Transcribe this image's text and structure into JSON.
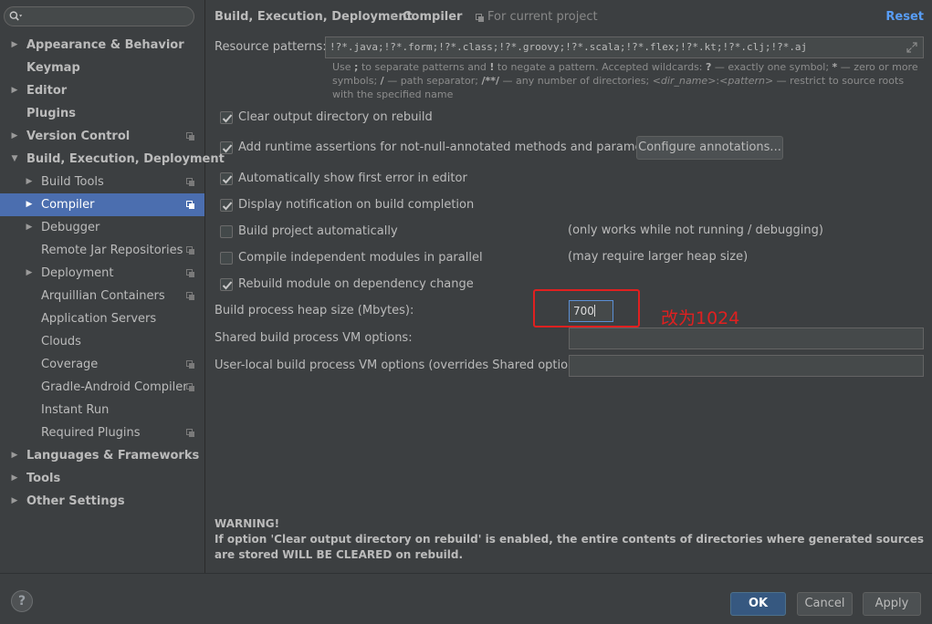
{
  "search": {
    "placeholder": ""
  },
  "sidebar": {
    "items": [
      {
        "label": "Appearance & Behavior",
        "bold": true,
        "expandable": true,
        "expanded": false,
        "level": 0,
        "project_icon": false
      },
      {
        "label": "Keymap",
        "bold": true,
        "expandable": false,
        "level": 0,
        "project_icon": false
      },
      {
        "label": "Editor",
        "bold": true,
        "expandable": true,
        "expanded": false,
        "level": 0,
        "project_icon": false
      },
      {
        "label": "Plugins",
        "bold": true,
        "expandable": false,
        "level": 0,
        "project_icon": false
      },
      {
        "label": "Version Control",
        "bold": true,
        "expandable": true,
        "expanded": false,
        "level": 0,
        "project_icon": true
      },
      {
        "label": "Build, Execution, Deployment",
        "bold": true,
        "expandable": true,
        "expanded": true,
        "level": 0,
        "project_icon": false
      },
      {
        "label": "Build Tools",
        "bold": false,
        "expandable": true,
        "expanded": false,
        "level": 1,
        "project_icon": true
      },
      {
        "label": "Compiler",
        "bold": false,
        "expandable": true,
        "expanded": false,
        "level": 1,
        "project_icon": true,
        "selected": true
      },
      {
        "label": "Debugger",
        "bold": false,
        "expandable": true,
        "expanded": false,
        "level": 1,
        "project_icon": false
      },
      {
        "label": "Remote Jar Repositories",
        "bold": false,
        "expandable": false,
        "level": 1,
        "project_icon": true
      },
      {
        "label": "Deployment",
        "bold": false,
        "expandable": true,
        "expanded": false,
        "level": 1,
        "project_icon": true
      },
      {
        "label": "Arquillian Containers",
        "bold": false,
        "expandable": false,
        "level": 1,
        "project_icon": true
      },
      {
        "label": "Application Servers",
        "bold": false,
        "expandable": false,
        "level": 1,
        "project_icon": false
      },
      {
        "label": "Clouds",
        "bold": false,
        "expandable": false,
        "level": 1,
        "project_icon": false
      },
      {
        "label": "Coverage",
        "bold": false,
        "expandable": false,
        "level": 1,
        "project_icon": true
      },
      {
        "label": "Gradle-Android Compiler",
        "bold": false,
        "expandable": false,
        "level": 1,
        "project_icon": true
      },
      {
        "label": "Instant Run",
        "bold": false,
        "expandable": false,
        "level": 1,
        "project_icon": false
      },
      {
        "label": "Required Plugins",
        "bold": false,
        "expandable": false,
        "level": 1,
        "project_icon": true
      },
      {
        "label": "Languages & Frameworks",
        "bold": true,
        "expandable": true,
        "expanded": false,
        "level": 0,
        "project_icon": false
      },
      {
        "label": "Tools",
        "bold": true,
        "expandable": true,
        "expanded": false,
        "level": 0,
        "project_icon": false
      },
      {
        "label": "Other Settings",
        "bold": true,
        "expandable": true,
        "expanded": false,
        "level": 0,
        "project_icon": false
      }
    ]
  },
  "header": {
    "crumb1": "Build, Execution, Deployment",
    "separator": "›",
    "crumb2": "Compiler",
    "for_project": "For current project",
    "reset": "Reset"
  },
  "resource": {
    "label": "Resource patterns:",
    "value": "!?*.java;!?*.form;!?*.class;!?*.groovy;!?*.scala;!?*.flex;!?*.kt;!?*.clj;!?*.aj"
  },
  "hint": {
    "p1": "Use ",
    "s1": ";",
    "p2": " to separate patterns and ",
    "s2": "!",
    "p3": " to negate a pattern. Accepted wildcards: ",
    "s3": "?",
    "p4": " — exactly one symbol; ",
    "s4": "*",
    "p5": " — zero or more symbols; ",
    "s5": "/",
    "p6": " — path separator; ",
    "s6": "/**/",
    "p7": " — any number of directories; ",
    "s7": "<dir_name>",
    "p8": ":",
    "s8": "<pattern>",
    "p9": " — restrict to source roots with the specified name"
  },
  "options": {
    "clear_output": {
      "label": "Clear output directory on rebuild",
      "checked": true
    },
    "runtime_assertions": {
      "label": "Add runtime assertions for not-null-annotated methods and parameters",
      "checked": true
    },
    "configure_annotations": "Configure annotations...",
    "show_first_error": {
      "label": "Automatically show first error in editor",
      "checked": true
    },
    "display_notification": {
      "label": "Display notification on build completion",
      "checked": true
    },
    "build_automatically": {
      "label": "Build project automatically",
      "checked": false,
      "note": "(only works while not running / debugging)"
    },
    "compile_parallel": {
      "label": "Compile independent modules in parallel",
      "checked": false,
      "note": "(may require larger heap size)"
    },
    "rebuild_module": {
      "label": "Rebuild module on dependency change",
      "checked": true
    }
  },
  "heap": {
    "label": "Build process heap size (Mbytes):",
    "value": "700"
  },
  "shared_vm": {
    "label": "Shared build process VM options:",
    "value": ""
  },
  "local_vm": {
    "label": "User-local build process VM options (overrides Shared options):",
    "value": ""
  },
  "annotation": {
    "text": "改为1024",
    "color": "#e02020"
  },
  "warning": {
    "title": "WARNING!",
    "body": "If option 'Clear output directory on rebuild' is enabled, the entire contents of directories where generated sources are stored WILL BE CLEARED on rebuild."
  },
  "footer": {
    "help": "?",
    "ok": "OK",
    "cancel": "Cancel",
    "apply": "Apply"
  },
  "colors": {
    "background": "#3c3f41",
    "selection": "#4b6eaf",
    "link": "#589df6",
    "primary_button": "#365880"
  }
}
